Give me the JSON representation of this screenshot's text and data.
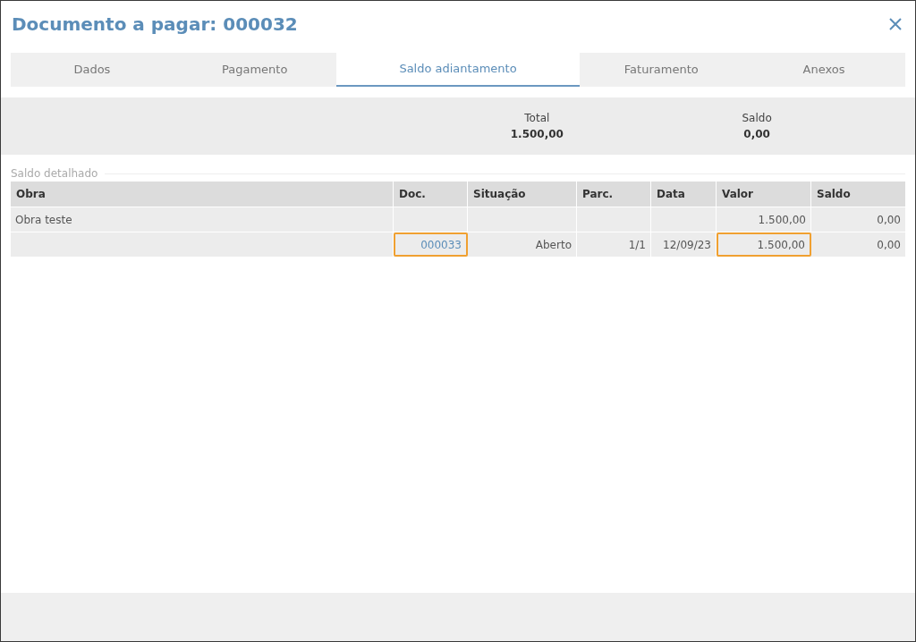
{
  "dialog": {
    "title": "Documento a pagar: 000032"
  },
  "tabs": [
    {
      "label": "Dados",
      "selected": false
    },
    {
      "label": "Pagamento",
      "selected": false
    },
    {
      "label": "Saldo adiantamento",
      "selected": true
    },
    {
      "label": "Faturamento",
      "selected": false
    },
    {
      "label": "Anexos",
      "selected": false
    }
  ],
  "summary": [
    {
      "label": "Total",
      "value": "1.500,00"
    },
    {
      "label": "Saldo",
      "value": "0,00"
    }
  ],
  "section": {
    "title": "Saldo detalhado"
  },
  "table": {
    "columns": [
      "Obra",
      "Doc.",
      "Situação",
      "Parc.",
      "Data",
      "Valor",
      "Saldo"
    ],
    "rows": [
      {
        "cells": [
          {
            "text": "Obra teste",
            "highlighted": false
          },
          {},
          {},
          {},
          {},
          {
            "text": "1.500,00",
            "highlighted": false
          },
          {
            "text": "0,00",
            "highlighted": false
          }
        ]
      },
      {
        "cells": [
          {},
          {
            "text": "000033",
            "link": true,
            "highlighted": true
          },
          {
            "text": "Aberto",
            "highlighted": false
          },
          {
            "text": "1/1",
            "highlighted": false
          },
          {
            "text": "12/09/23",
            "highlighted": false
          },
          {
            "text": "1.500,00",
            "highlighted": true
          },
          {
            "text": "0,00",
            "highlighted": false
          }
        ]
      }
    ]
  }
}
